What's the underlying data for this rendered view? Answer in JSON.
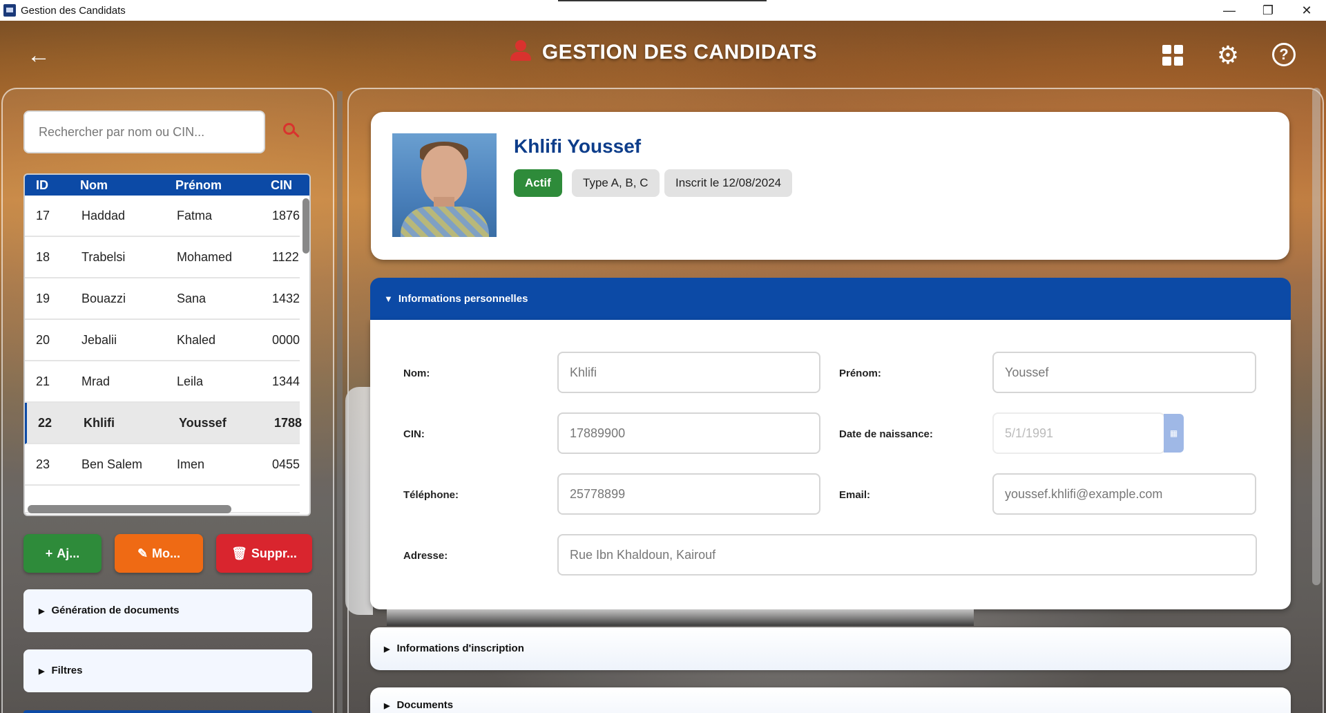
{
  "window": {
    "title": "Gestion des Candidats",
    "minimize": "—",
    "restore": "❐",
    "close": "✕"
  },
  "header": {
    "back_icon": "←",
    "title": "GESTION DES CANDIDATS",
    "gear_glyph": "⚙",
    "help_glyph": "?"
  },
  "search": {
    "placeholder": "Rechercher par nom ou CIN..."
  },
  "table": {
    "columns": [
      "ID",
      "Nom",
      "Prénom",
      "CIN"
    ],
    "rows": [
      {
        "id": "17",
        "nom": "Haddad",
        "prenom": "Fatma",
        "cin": "1876"
      },
      {
        "id": "18",
        "nom": "Trabelsi",
        "prenom": "Mohamed",
        "cin": "1122"
      },
      {
        "id": "19",
        "nom": "Bouazzi",
        "prenom": "Sana",
        "cin": "1432"
      },
      {
        "id": "20",
        "nom": "Jebalii",
        "prenom": "Khaled",
        "cin": "0000"
      },
      {
        "id": "21",
        "nom": "Mrad",
        "prenom": "Leila",
        "cin": "1344"
      },
      {
        "id": "22",
        "nom": "Khlifi",
        "prenom": "Youssef",
        "cin": "1788"
      },
      {
        "id": "23",
        "nom": "Ben Salem",
        "prenom": "Imen",
        "cin": "0455"
      }
    ],
    "selected_index": 5
  },
  "actions": {
    "add_label": "Aj...",
    "add_glyph": "+",
    "edit_label": "Mo...",
    "edit_glyph": "✎",
    "delete_label": "Suppr...",
    "delete_glyph": "🗑"
  },
  "left_sections": {
    "documents_generation": "Génération de documents",
    "filters": "Filtres",
    "collapsed_glyph": "▶"
  },
  "candidate": {
    "full_name": "Khlifi Youssef",
    "status": "Actif",
    "license_types": "Type A, B, C",
    "registered": "Inscrit le 12/08/2024"
  },
  "personal_info": {
    "section_title": "Informations personnelles",
    "expanded_glyph": "▼",
    "labels": {
      "nom": "Nom:",
      "prenom": "Prénom:",
      "cin": "CIN:",
      "date_naissance": "Date de naissance:",
      "telephone": "Téléphone:",
      "email": "Email:",
      "adresse": "Adresse:"
    },
    "values": {
      "nom": "Khlifi",
      "prenom": "Youssef",
      "cin": "17889900",
      "date_naissance": "5/1/1991",
      "telephone": "25778899",
      "email": "youssef.khlifi@example.com",
      "adresse": "Rue Ibn Khaldoun, Kairouf"
    },
    "calendar_glyph": "▦"
  },
  "right_sections": {
    "inscription": "Informations d'inscription",
    "documents": "Documents",
    "collapsed_glyph": "▶"
  },
  "colors": {
    "primary_blue": "#0c4aa6",
    "success_green": "#2e8b3a",
    "warning_orange": "#ef6a14",
    "danger_red": "#d9252e",
    "name_blue": "#0d3d8a"
  }
}
